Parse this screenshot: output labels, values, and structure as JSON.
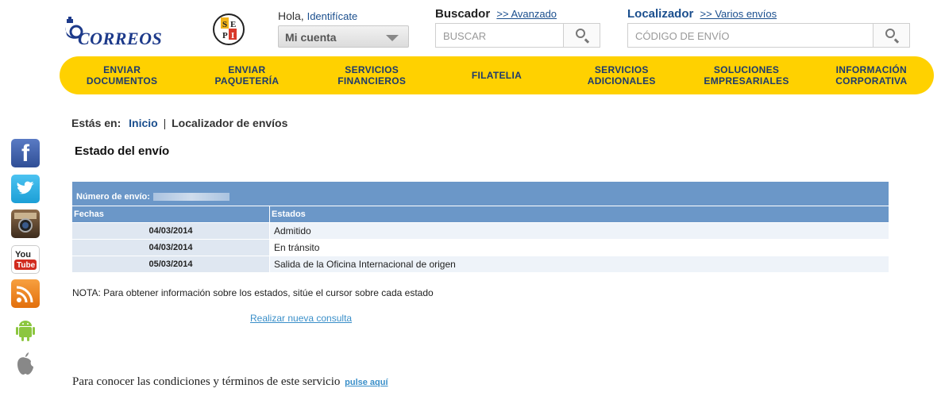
{
  "header": {
    "logo_text": "CORREOS",
    "hola": "Hola,",
    "identificate": "Identifícate",
    "cuenta_label": "Mi cuenta",
    "buscador": {
      "title": "Buscador",
      "advanced": ">> Avanzado",
      "placeholder": "BUSCAR"
    },
    "localizador": {
      "title": "Localizador",
      "advanced": ">> Varios envíos",
      "placeholder": "CÓDIGO DE ENVÍO"
    }
  },
  "nav": [
    {
      "label": "ENVIAR\nDOCUMENTOS"
    },
    {
      "label": "ENVIAR\nPAQUETERÍA"
    },
    {
      "label": "SERVICIOS\nFINANCIEROS"
    },
    {
      "label": "FILATELIA"
    },
    {
      "label": "SERVICIOS\nADICIONALES"
    },
    {
      "label": "SOLUCIONES\nEMPRESARIALES"
    },
    {
      "label": "INFORMACIÓN\nCORPORATIVA"
    }
  ],
  "social": [
    {
      "icon": "facebook-icon"
    },
    {
      "icon": "twitter-icon"
    },
    {
      "icon": "instagram-icon"
    },
    {
      "icon": "youtube-icon"
    },
    {
      "icon": "rss-icon"
    },
    {
      "icon": "android-icon"
    },
    {
      "icon": "apple-icon"
    }
  ],
  "breadcrumb": {
    "prefix": "Estás en:",
    "home": "Inicio",
    "separator": "|",
    "current": "Localizador de envíos"
  },
  "section_title": "Estado del envío",
  "table": {
    "number_label": "Número de envío:",
    "col_dates": "Fechas",
    "col_states": "Estados",
    "rows": [
      {
        "date": "04/03/2014",
        "state": "Admitido"
      },
      {
        "date": "04/03/2014",
        "state": "En tránsito"
      },
      {
        "date": "05/03/2014",
        "state": "Salida de la Oficina Internacional de origen"
      }
    ]
  },
  "nota": "NOTA: Para obtener información sobre los estados, sitúe el cursor sobre cada estado",
  "nueva_consulta": "Realizar nueva consulta",
  "footer": {
    "text": "Para conocer las condiciones y términos de este servicio",
    "link": "pulse aquí"
  },
  "colors": {
    "nav_bg": "#ffd100",
    "table_header": "#6b97c8",
    "brand_blue": "#1b4f8e"
  }
}
